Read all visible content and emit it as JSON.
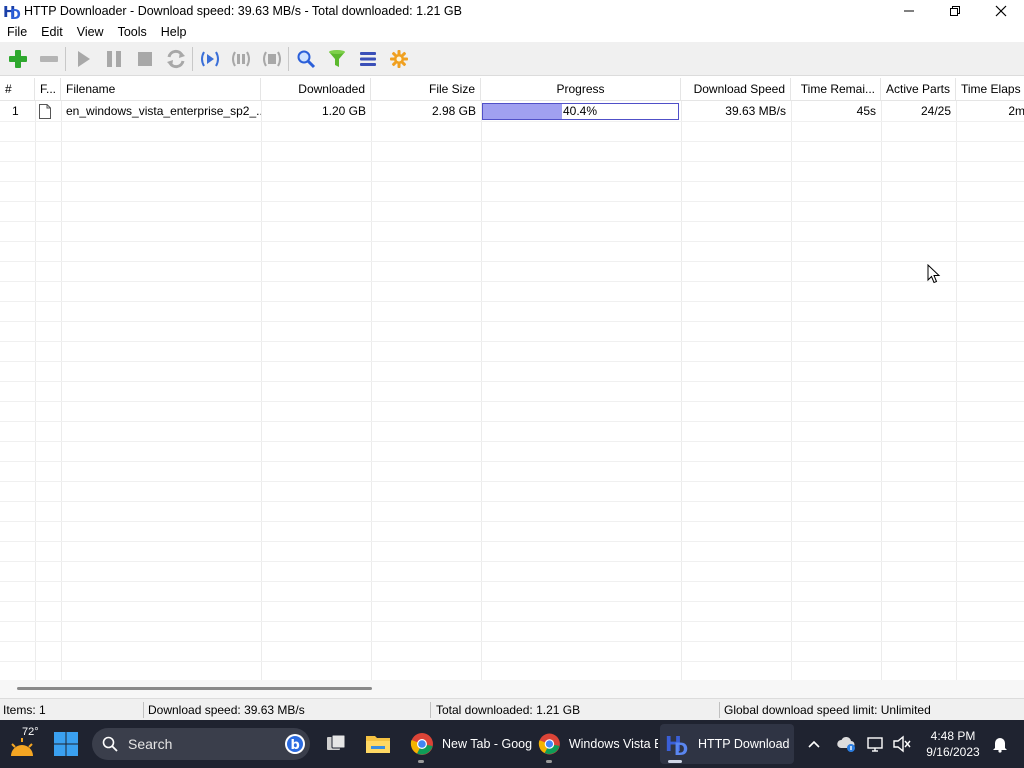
{
  "window": {
    "title": "HTTP Downloader - Download speed: 39.63 MB/s - Total downloaded: 1.21 GB",
    "logo_icon": "hd-logo-icon"
  },
  "menu": [
    "File",
    "Edit",
    "View",
    "Tools",
    "Help"
  ],
  "toolbar": {
    "buttons": [
      "add-download-icon",
      "remove-icon",
      "start-icon",
      "pause-icon",
      "stop-icon",
      "restart-icon",
      "pause-active-icon",
      "pause-all-icon",
      "stop-all-icon",
      "search-icon",
      "filter-icon",
      "queue-icon",
      "options-icon"
    ]
  },
  "columns": [
    "#",
    "F...",
    "Filename",
    "Downloaded",
    "File Size",
    "Progress",
    "Download Speed",
    "Time Remai...",
    "Active Parts",
    "Time Elaps"
  ],
  "rows": [
    {
      "num": "1",
      "filename": "en_windows_vista_enterprise_sp2_...",
      "downloaded": "1.20 GB",
      "file_size": "2.98 GB",
      "progress_text": "40.4%",
      "progress_value": 0.404,
      "download_speed": "39.63 MB/s",
      "time_remaining": "45s",
      "active_parts": "24/25",
      "time_elapsed": "2m"
    }
  ],
  "status": {
    "items": "Items: 1",
    "download_speed": "Download speed: 39.63 MB/s",
    "total_downloaded": "Total downloaded: 1.21 GB",
    "speed_limit": "Global download speed limit: Unlimited"
  },
  "taskbar": {
    "weather_temp": "72°",
    "search_placeholder": "Search",
    "apps": [
      {
        "label": "New Tab - Goog"
      },
      {
        "label": "Windows Vista E"
      },
      {
        "label": "HTTP Download"
      }
    ],
    "time": "4:48 PM",
    "date": "9/16/2023"
  },
  "colors": {
    "progress_fill": "#a0a0f0",
    "progress_border": "#5050c8",
    "taskbar_bg": "#1f2330"
  }
}
